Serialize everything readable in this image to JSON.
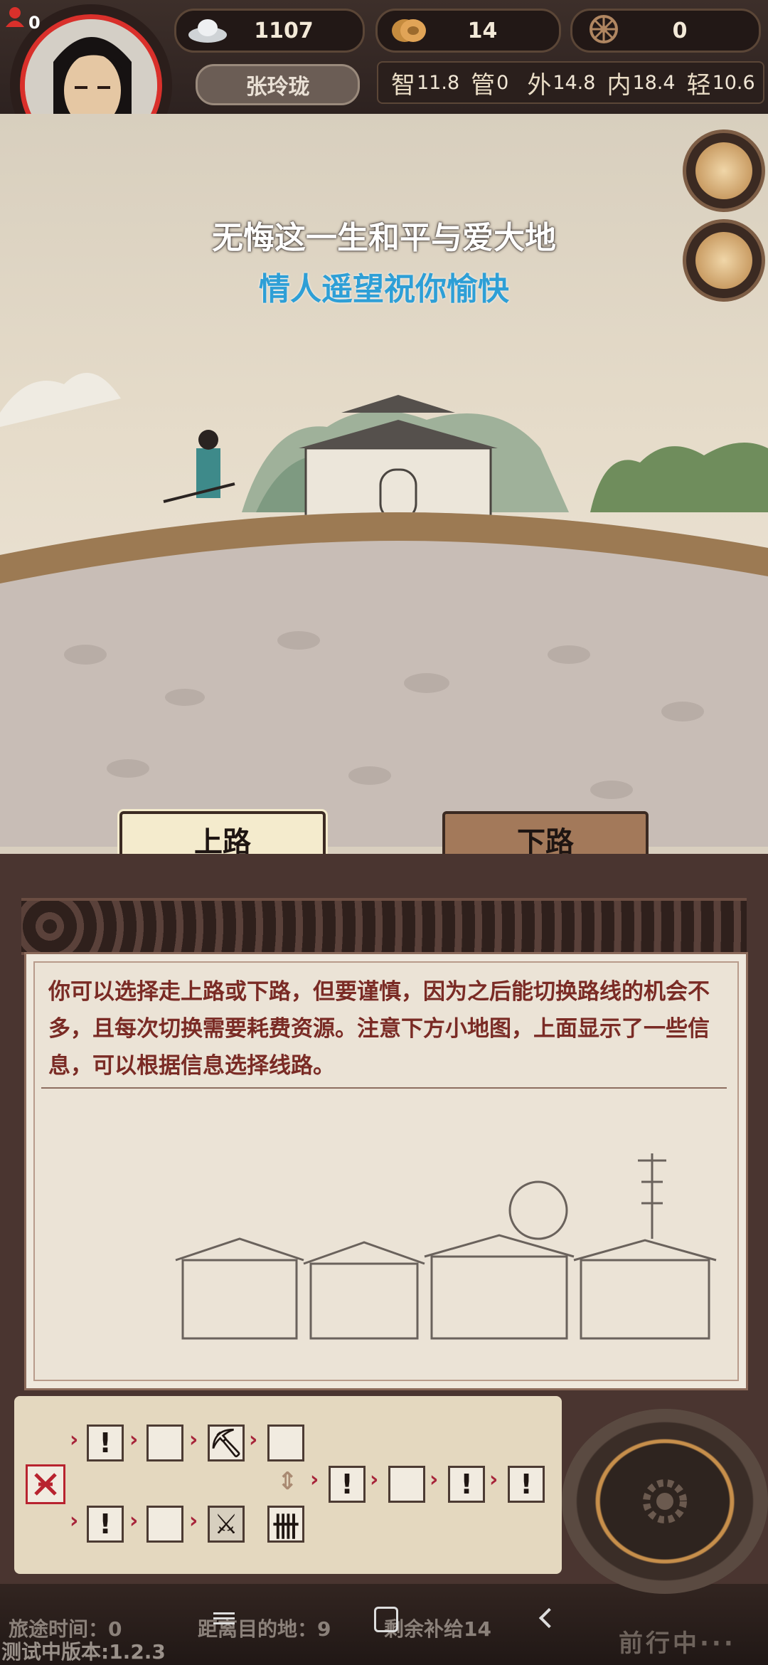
{
  "player": {
    "level_badge": "0",
    "name": "张玲珑"
  },
  "resources": {
    "silver": "1107",
    "coins": "14",
    "wheel": "0"
  },
  "stats": [
    {
      "label": "智",
      "value": "11.8"
    },
    {
      "label": "管",
      "value": "0"
    },
    {
      "label": "外",
      "value": "14.8"
    },
    {
      "label": "内",
      "value": "18.4"
    },
    {
      "label": "轻",
      "value": "10.6"
    }
  ],
  "poem": {
    "line1": "无悔这一生和平与爱大地",
    "line2": "情人遥望祝你愉快",
    "line2_color": "#2e9fd6"
  },
  "route": {
    "up": "上路",
    "down": "下路"
  },
  "hint": "你可以选择走上路或下路，但要谨慎，因为之后能切换路线的机会不多，且每次切换需要耗费资源。注意下方小地图，上面显示了一些信息，可以根据信息选择线路。",
  "minimap": {
    "start_icon": "swords-glyph-icon",
    "top_row": [
      "!",
      "",
      "⛏",
      ""
    ],
    "bottom_row": [
      "!",
      "",
      "⚔",
      "卌"
    ],
    "merged_row": [
      "!",
      "",
      "!",
      "!"
    ],
    "swap_icon": "⇕",
    "arrow": "›"
  },
  "footer": {
    "travel_time": "旅途时间：0",
    "distance": "距离目的地：9",
    "supply": "剩余补给14",
    "version": "测试中版本:1.2.3",
    "status": "前行中···"
  },
  "colors": {
    "accent": "#d9302b",
    "route_selected": "#f4ebcd",
    "route_other": "#a3795a"
  }
}
